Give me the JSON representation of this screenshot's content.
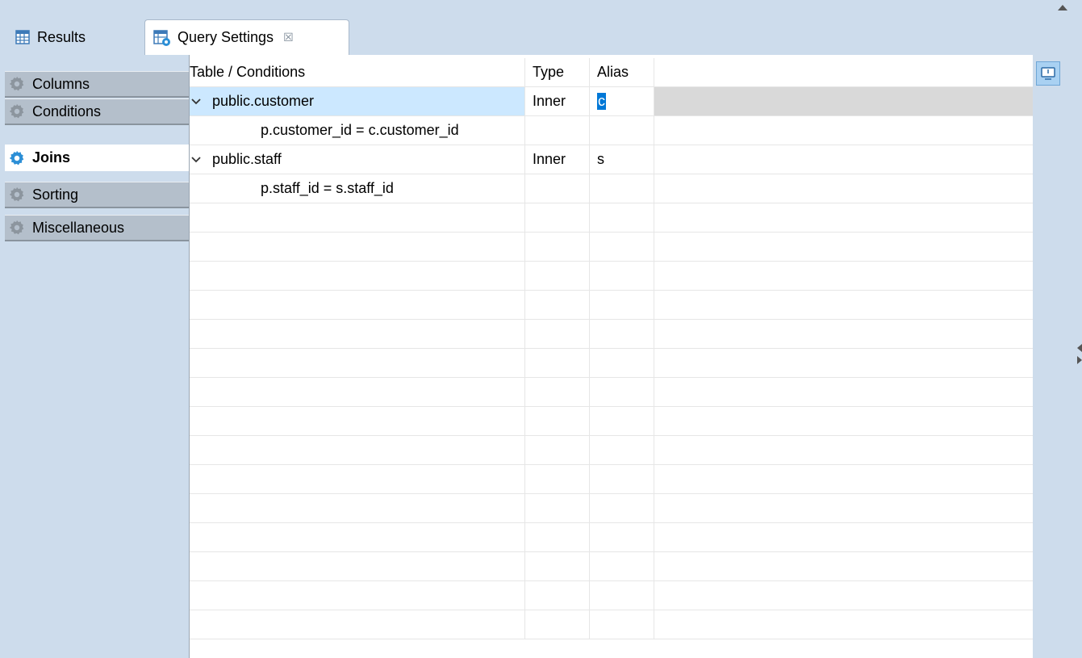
{
  "tabs": [
    {
      "label": "Results",
      "icon": "table-grid-icon",
      "active": false
    },
    {
      "label": "Query Settings",
      "icon": "query-settings-icon",
      "active": true,
      "close_glyph": "☒"
    }
  ],
  "sidebar": {
    "items": [
      {
        "label": "Columns",
        "icon": "gear-icon",
        "active": false
      },
      {
        "label": "Conditions",
        "icon": "gear-icon",
        "active": false
      },
      {
        "label": "Joins",
        "icon": "gear-icon",
        "active": true
      },
      {
        "label": "Sorting",
        "icon": "gear-icon",
        "active": false
      },
      {
        "label": "Miscellaneous",
        "icon": "gear-icon",
        "active": false
      }
    ]
  },
  "table": {
    "headers": [
      "Table / Conditions",
      "Type",
      "Alias",
      ""
    ],
    "rows": [
      {
        "kind": "table",
        "name": "public.customer",
        "type": "Inner",
        "alias": "c",
        "selected": true,
        "expanded": true
      },
      {
        "kind": "condition",
        "name": "p.customer_id = c.customer_id",
        "type": "",
        "alias": ""
      },
      {
        "kind": "table",
        "name": "public.staff",
        "type": "Inner",
        "alias": "s",
        "selected": false,
        "expanded": true
      },
      {
        "kind": "condition",
        "name": "p.staff_id = s.staff_id",
        "type": "",
        "alias": ""
      }
    ],
    "empty_rows": 15
  },
  "colors": {
    "background": "#cddcec",
    "selected_row": "#cce8ff",
    "selection_accent": "#0078d7",
    "gear_inactive": "#8c959e",
    "gear_active": "#2c8fd6"
  }
}
